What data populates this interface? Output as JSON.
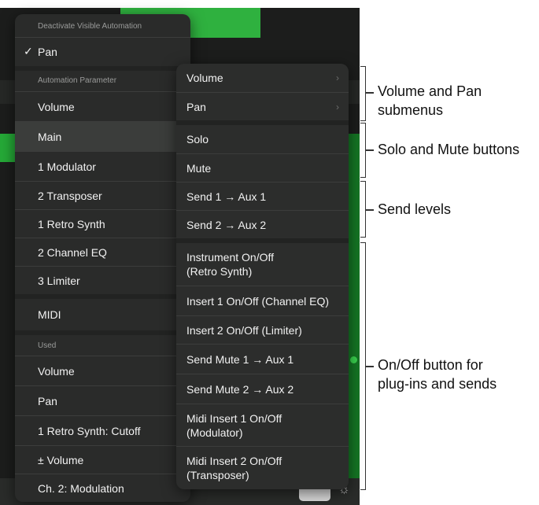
{
  "colors": {
    "menu_bg": "#2a2b2a",
    "app_bg": "#1c1d1c",
    "accent_green": "#2fb13f",
    "highlight": "#3b3d3b"
  },
  "left_menu": {
    "header": "Deactivate Visible Automation",
    "checked_item": "Pan",
    "check_glyph": "✓",
    "automation_section": "Automation Parameter",
    "parameters": [
      "Volume",
      "Main",
      "1 Modulator",
      "2 Transposer",
      "1 Retro Synth",
      "2 Channel EQ",
      "3 Limiter",
      "MIDI"
    ],
    "used_section": "Used",
    "used": [
      "Volume",
      "Pan",
      "1 Retro Synth: Cutoff",
      "± Volume",
      "Ch. 2: Modulation"
    ]
  },
  "right_menu": {
    "items": [
      "Volume",
      "Pan",
      "Solo",
      "Mute",
      "Send 1 → Aux 1",
      "Send 2 → Aux 2",
      "Instrument On/Off\n(Retro Synth)",
      "Insert 1 On/Off (Channel EQ)",
      "Insert 2 On/Off (Limiter)",
      "Send Mute 1 → Aux 1",
      "Send Mute 2 → Aux 2",
      "Midi Insert 1 On/Off\n(Modulator)",
      "Midi Insert 2 On/Off\n(Transposer)"
    ],
    "chevron_icon": "chevron-right-icon",
    "chevron_glyph": "›"
  },
  "annotations": [
    "Volume and Pan\nsubmenus",
    "Solo and Mute buttons",
    "Send levels",
    "On/Off button for\nplug-ins and sends"
  ],
  "bottom_bar": {
    "light_icon": "light-bulb-icon",
    "light_glyph": "☼"
  }
}
